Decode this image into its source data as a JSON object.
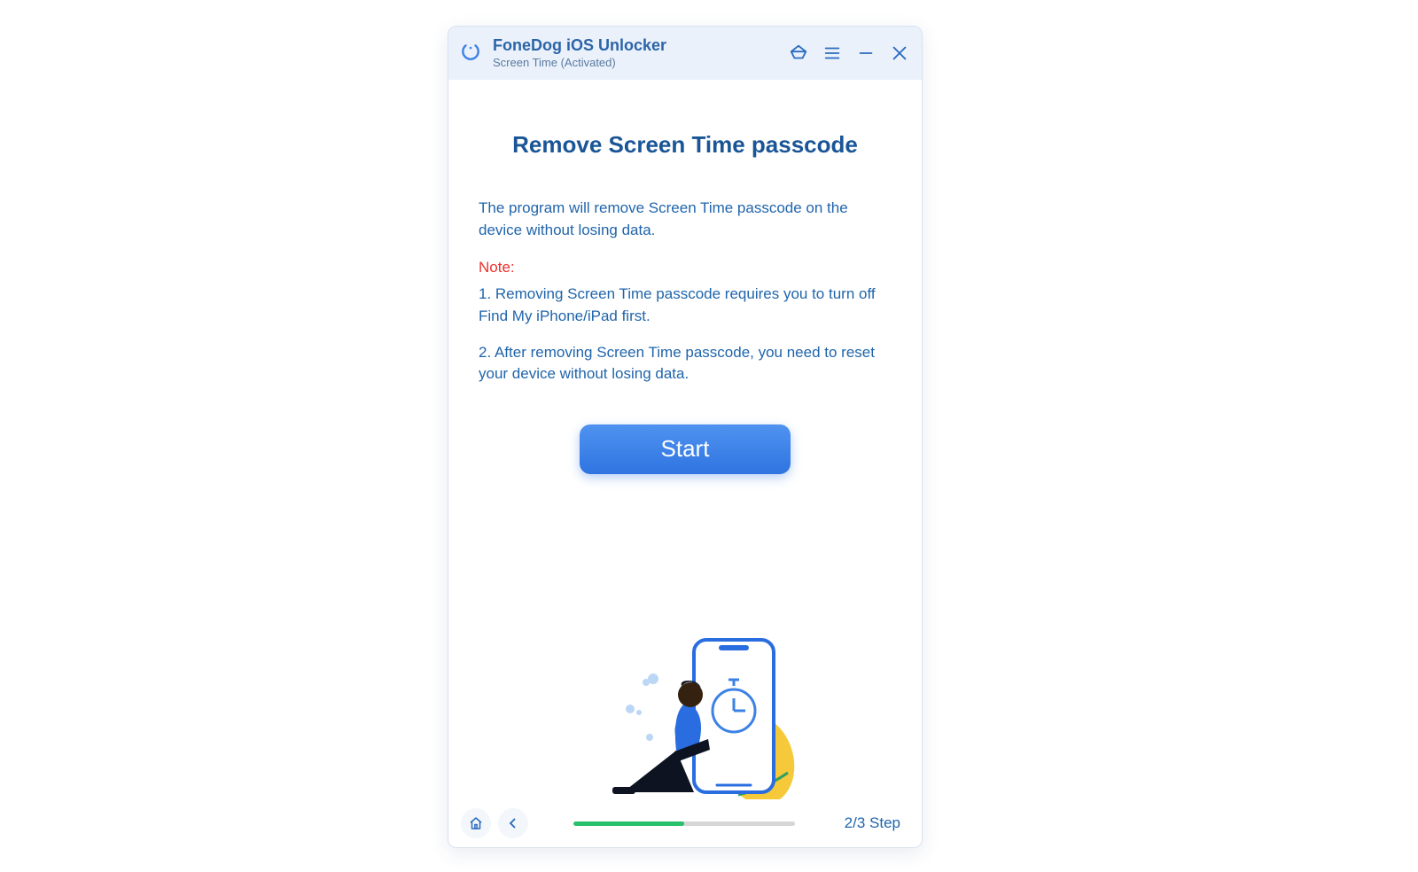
{
  "window": {
    "appTitle": "FoneDog iOS Unlocker",
    "appSubtitle": "Screen Time  (Activated)"
  },
  "main": {
    "heading": "Remove Screen Time passcode",
    "intro": "The program will remove Screen Time passcode on the device without losing data.",
    "noteLabel": "Note:",
    "note1": "1. Removing Screen Time passcode requires you to turn off Find My iPhone/iPad first.",
    "note2": "2. After removing Screen Time passcode, you need to reset your device without losing data.",
    "startButton": "Start"
  },
  "footer": {
    "step": "2/3 Step",
    "progressPercent": 50
  }
}
